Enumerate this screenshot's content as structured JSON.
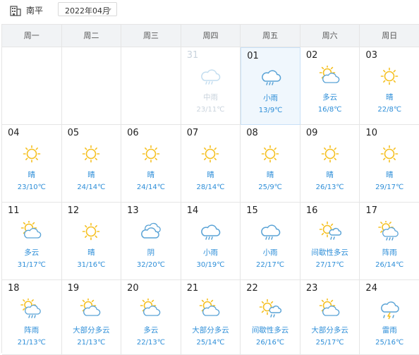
{
  "header": {
    "city": "南平",
    "month": "2022年04月"
  },
  "weekdays": [
    "周一",
    "周二",
    "周三",
    "周四",
    "周五",
    "周六",
    "周日"
  ],
  "colors": {
    "accent": "#2d8ed8",
    "sun": "#f5c021",
    "cloud": "#5aa3d6",
    "today_bg": "#f0f7fd"
  },
  "days": [
    {
      "empty": true
    },
    {
      "empty": true
    },
    {
      "empty": true
    },
    {
      "day": "31",
      "desc": "中雨",
      "temp": "23/11℃",
      "icon": "rain-icon",
      "past": true
    },
    {
      "day": "01",
      "desc": "小雨",
      "temp": "13/9℃",
      "icon": "rain-icon",
      "today": true
    },
    {
      "day": "02",
      "desc": "多云",
      "temp": "16/8℃",
      "icon": "partly-cloudy-icon"
    },
    {
      "day": "03",
      "desc": "晴",
      "temp": "22/8℃",
      "icon": "sun-icon"
    },
    {
      "day": "04",
      "desc": "晴",
      "temp": "23/10℃",
      "icon": "sun-icon"
    },
    {
      "day": "05",
      "desc": "晴",
      "temp": "24/14℃",
      "icon": "sun-icon"
    },
    {
      "day": "06",
      "desc": "晴",
      "temp": "24/14℃",
      "icon": "sun-icon"
    },
    {
      "day": "07",
      "desc": "晴",
      "temp": "28/14℃",
      "icon": "sun-icon"
    },
    {
      "day": "08",
      "desc": "晴",
      "temp": "25/9℃",
      "icon": "sun-icon"
    },
    {
      "day": "09",
      "desc": "晴",
      "temp": "26/13℃",
      "icon": "sun-icon"
    },
    {
      "day": "10",
      "desc": "晴",
      "temp": "29/17℃",
      "icon": "sun-icon"
    },
    {
      "day": "11",
      "desc": "多云",
      "temp": "31/17℃",
      "icon": "partly-cloudy-icon"
    },
    {
      "day": "12",
      "desc": "晴",
      "temp": "31/16℃",
      "icon": "sun-icon"
    },
    {
      "day": "13",
      "desc": "阴",
      "temp": "32/20℃",
      "icon": "overcast-icon"
    },
    {
      "day": "14",
      "desc": "小雨",
      "temp": "30/19℃",
      "icon": "rain-icon"
    },
    {
      "day": "15",
      "desc": "小雨",
      "temp": "22/17℃",
      "icon": "rain-icon"
    },
    {
      "day": "16",
      "desc": "间歇性多云",
      "temp": "27/17℃",
      "icon": "intermittent-cloudy-icon"
    },
    {
      "day": "17",
      "desc": "阵雨",
      "temp": "26/14℃",
      "icon": "showers-icon"
    },
    {
      "day": "18",
      "desc": "阵雨",
      "temp": "21/13℃",
      "icon": "showers-icon"
    },
    {
      "day": "19",
      "desc": "大部分多云",
      "temp": "21/13℃",
      "icon": "partly-cloudy-icon"
    },
    {
      "day": "20",
      "desc": "多云",
      "temp": "22/13℃",
      "icon": "partly-cloudy-icon"
    },
    {
      "day": "21",
      "desc": "大部分多云",
      "temp": "25/14℃",
      "icon": "partly-cloudy-icon"
    },
    {
      "day": "22",
      "desc": "间歇性多云",
      "temp": "26/16℃",
      "icon": "intermittent-cloudy-icon"
    },
    {
      "day": "23",
      "desc": "大部分多云",
      "temp": "25/17℃",
      "icon": "partly-cloudy-icon"
    },
    {
      "day": "24",
      "desc": "雷雨",
      "temp": "25/16℃",
      "icon": "thunder-rain-icon"
    }
  ]
}
